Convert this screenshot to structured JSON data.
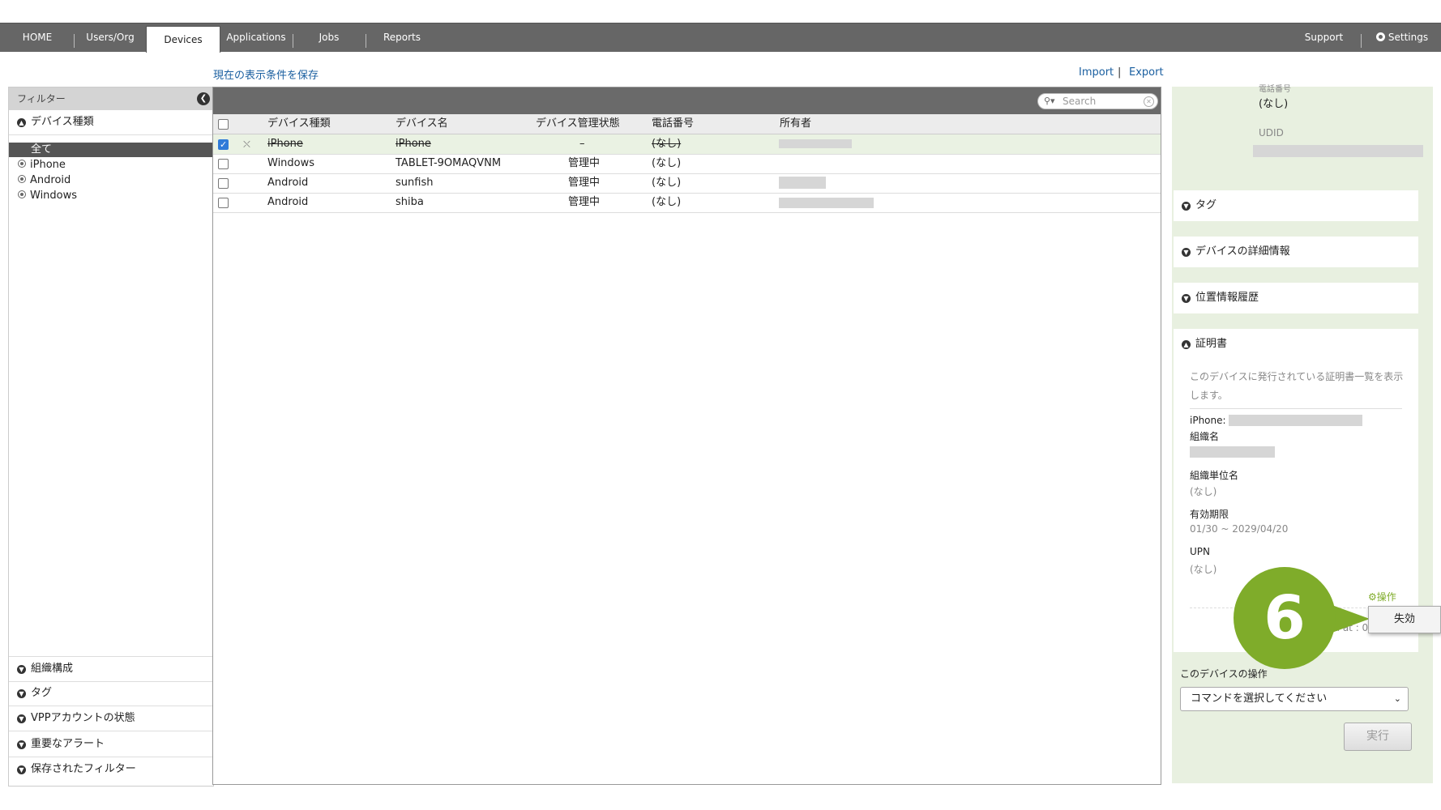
{
  "nav": {
    "tabs": [
      {
        "label": "HOME"
      },
      {
        "label": "Users/Org"
      },
      {
        "label": "Devices"
      },
      {
        "label": "Applications"
      },
      {
        "label": "Jobs"
      },
      {
        "label": "Reports"
      }
    ],
    "support": "Support",
    "settings": "Settings"
  },
  "subbar": {
    "save_filter": "現在の表示条件を保存",
    "import": "Import",
    "sep": "|",
    "export": "Export"
  },
  "sidebar": {
    "title": "フィルター",
    "device_type_header": "デバイス種類",
    "items": [
      {
        "label": "全て",
        "selected": true
      },
      {
        "label": "iPhone"
      },
      {
        "label": "Android"
      },
      {
        "label": "Windows"
      }
    ],
    "bottom_sections": [
      {
        "label": "組織構成"
      },
      {
        "label": "タグ"
      },
      {
        "label": "VPPアカウントの状態"
      },
      {
        "label": "重要なアラート"
      },
      {
        "label": "保存されたフィルター"
      }
    ]
  },
  "search": {
    "placeholder": "Search"
  },
  "table": {
    "headers": [
      "デバイス種類",
      "デバイス名",
      "デバイス管理状態",
      "電話番号",
      "所有者"
    ],
    "rows": [
      {
        "type": "iPhone",
        "name": "iPhone",
        "status": "–",
        "phone": "(なし)",
        "checked": true
      },
      {
        "type": "Windows",
        "name": "TABLET-9OMAQVNM",
        "status": "管理中",
        "phone": "(なし)"
      },
      {
        "type": "Android",
        "name": "sunfish",
        "status": "管理中",
        "phone": "(なし)"
      },
      {
        "type": "Android",
        "name": "shiba",
        "status": "管理中",
        "phone": "(なし)"
      }
    ]
  },
  "right": {
    "phone_label": "電話番号",
    "phone_value": "(なし)",
    "udid_label": "UDID",
    "sections": [
      {
        "label": "タグ"
      },
      {
        "label": "デバイスの詳細情報"
      },
      {
        "label": "位置情報履歴"
      }
    ],
    "cert": {
      "title": "証明書",
      "desc": "このデバイスに発行されている証明書一覧を表示します。",
      "item_prefix": "iPhone:",
      "org_label": "組織名",
      "unit_label": "組織単位名",
      "unit_value": "(なし)",
      "expiry_label": "有効期限",
      "expiry_value": "01/30 ~ 2029/04/20",
      "upn_label": "UPN",
      "upn_value": "(なし)",
      "action_label": "操作",
      "issued": "ed at : 01/30"
    },
    "ops_title": "このデバイスの操作",
    "command_placeholder": "コマンドを選択してください",
    "exec": "実行"
  },
  "callout": {
    "step": "6",
    "popup_label": "失効"
  },
  "colors": {
    "accent_green": "#7fac2a",
    "nav_bg": "#666666",
    "link": "#1a5fa0"
  }
}
